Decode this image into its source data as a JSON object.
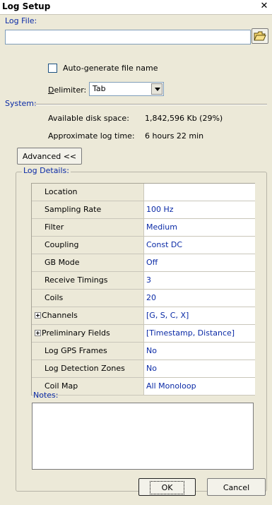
{
  "window": {
    "title": "Log Setup",
    "close_glyph": "✕"
  },
  "log_file": {
    "label": "Log File:",
    "value": "",
    "browse_icon": "folder-open-icon"
  },
  "autogen": {
    "label": "Auto-generate file name",
    "checked": false
  },
  "delimiter": {
    "label_accel": "D",
    "label_rest": "elimiter:",
    "value": "Tab"
  },
  "system": {
    "label": "System:",
    "disk_label": "Available disk space:",
    "disk_value": "1,842,596 Kb  (29%)",
    "time_label": "Approximate log time:",
    "time_value": "6 hours 22 min"
  },
  "advanced_button": "Advanced <<",
  "log_details": {
    "label": "Log Details:",
    "rows": [
      {
        "key": "Location",
        "value": "",
        "expandable": false
      },
      {
        "key": "Sampling Rate",
        "value": "100 Hz",
        "expandable": false
      },
      {
        "key": "Filter",
        "value": "Medium",
        "expandable": false
      },
      {
        "key": "Coupling",
        "value": "Const DC",
        "expandable": false
      },
      {
        "key": "GB Mode",
        "value": "Off",
        "expandable": false
      },
      {
        "key": "Receive Timings",
        "value": "3",
        "expandable": false
      },
      {
        "key": "Coils",
        "value": "20",
        "expandable": false
      },
      {
        "key": "Channels",
        "value": "[G, S, C, X]",
        "expandable": true
      },
      {
        "key": "Preliminary Fields",
        "value": "[Timestamp, Distance]",
        "expandable": true
      },
      {
        "key": "Log GPS Frames",
        "value": "No",
        "expandable": false
      },
      {
        "key": "Log Detection Zones",
        "value": "No",
        "expandable": false
      },
      {
        "key": "Coil Map",
        "value": "All Monoloop",
        "expandable": false
      }
    ]
  },
  "notes": {
    "label": "Notes:",
    "value": ""
  },
  "buttons": {
    "ok": "OK",
    "cancel": "Cancel"
  },
  "colors": {
    "dialog_bg": "#ece9d8",
    "label_blue": "#0a2aa6",
    "value_blue": "#0a2aa6"
  }
}
